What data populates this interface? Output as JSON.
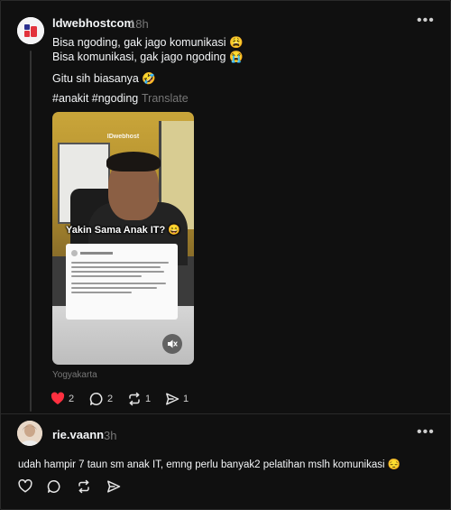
{
  "post": {
    "username": "ldwebhostcom",
    "time": "18h",
    "lines": [
      "Bisa ngoding, gak jago komunikasi 😩",
      "Bisa komunikasi, gak jago ngoding 😭",
      "Gitu sih biasanya 🤣"
    ],
    "hashtags": "#anakit #ngoding",
    "translate_label": "Translate",
    "media": {
      "watermark": "IDwebhost",
      "caption": "Yakin Sama Anak IT? 😄"
    },
    "location": "Yogyakarta",
    "counts": {
      "likes": "2",
      "replies": "2",
      "reposts": "1",
      "shares": "1"
    },
    "liked_color": "#ff3040"
  },
  "reply": {
    "username": "rie.vaann",
    "time": "3h",
    "text": "udah hampir 7 taun sm anak IT, emng perlu banyak2 pelatihan mslh komunikasi 😔"
  },
  "icons": [
    "more-icon",
    "heart-icon",
    "comment-icon",
    "repost-icon",
    "share-icon",
    "mute-icon"
  ]
}
